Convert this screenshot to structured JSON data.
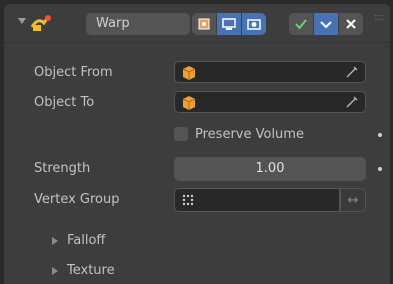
{
  "modifier": {
    "name": "Warp",
    "icon": "warp-modifier-icon",
    "visibility_icons": [
      "edit-mode-icon",
      "realtime-icon",
      "render-icon"
    ],
    "apply_icons": [
      "apply-check-icon",
      "dropdown-chevron-icon",
      "close-icon"
    ]
  },
  "fields": {
    "object_from_label": "Object From",
    "object_to_label": "Object To",
    "preserve_volume_label": "Preserve Volume",
    "preserve_volume_checked": false,
    "strength_label": "Strength",
    "strength_value": "1.00",
    "vertex_group_label": "Vertex Group"
  },
  "subpanels": {
    "falloff": "Falloff",
    "texture": "Texture"
  },
  "colors": {
    "accent_blue": "#4772b3",
    "check_green": "#6fd46f",
    "object_orange": "#f0a030"
  }
}
